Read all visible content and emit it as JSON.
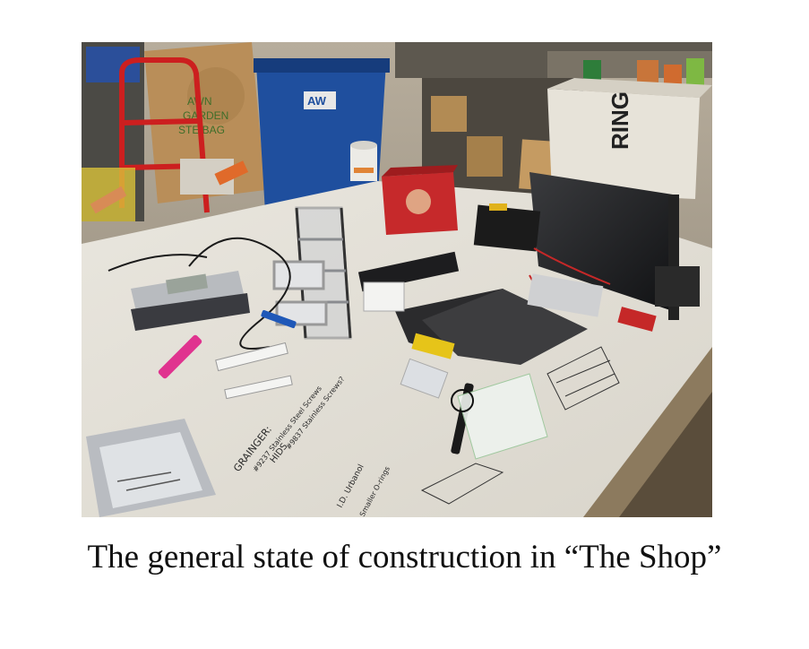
{
  "photo": {
    "subject": "workshop-table-with-construction-parts",
    "bag_text": [
      "AWN",
      "GARDEN",
      "STE BAG"
    ],
    "bin_logo": "AW",
    "crate_text": "RING",
    "notes": [
      "GRAINGER:",
      "#9237 Stainless Steel Screws",
      "HIDS",
      "#9837 Stainless Screws?",
      "I.D. Urbanol",
      "Smaller O-rings"
    ]
  },
  "caption": "The general state of construction in “The Shop”"
}
